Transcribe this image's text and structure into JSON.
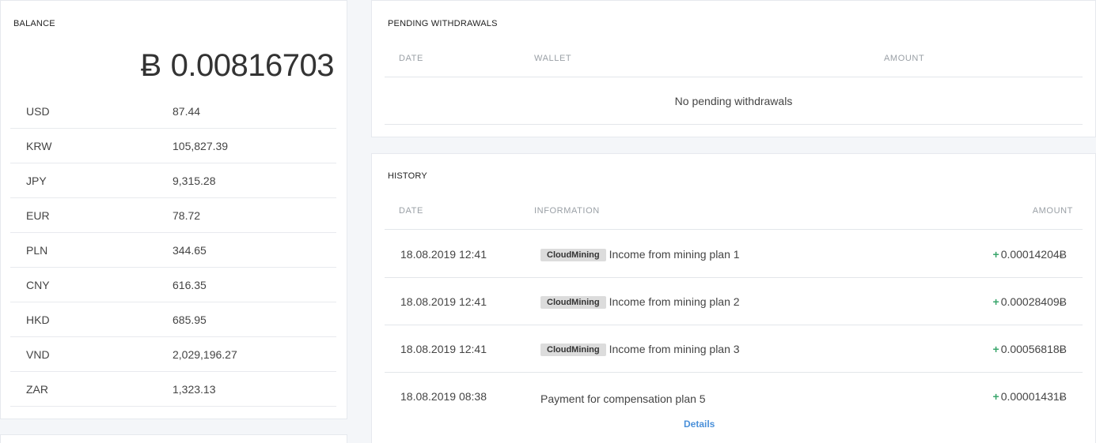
{
  "balance": {
    "title": "BALANCE",
    "symbol": "Ƀ",
    "amount": "0.00816703",
    "currencies": [
      {
        "code": "USD",
        "value": "87.44"
      },
      {
        "code": "KRW",
        "value": "105,827.39"
      },
      {
        "code": "JPY",
        "value": "9,315.28"
      },
      {
        "code": "EUR",
        "value": "78.72"
      },
      {
        "code": "PLN",
        "value": "344.65"
      },
      {
        "code": "CNY",
        "value": "616.35"
      },
      {
        "code": "HKD",
        "value": "685.95"
      },
      {
        "code": "VND",
        "value": "2,029,196.27"
      },
      {
        "code": "ZAR",
        "value": "1,323.13"
      }
    ]
  },
  "pending": {
    "title": "PENDING WITHDRAWALS",
    "columns": {
      "date": "DATE",
      "wallet": "WALLET",
      "amount": "AMOUNT"
    },
    "empty_text": "No pending withdrawals"
  },
  "history": {
    "title": "HISTORY",
    "columns": {
      "date": "DATE",
      "information": "INFORMATION",
      "amount": "AMOUNT"
    },
    "rows": [
      {
        "date": "18.08.2019 12:41",
        "tag": "CloudMining",
        "text": "Income from mining plan 1",
        "sign": "+",
        "amount": "0.00014204Ƀ"
      },
      {
        "date": "18.08.2019 12:41",
        "tag": "CloudMining",
        "text": "Income from mining plan 2",
        "sign": "+",
        "amount": "0.00028409Ƀ"
      },
      {
        "date": "18.08.2019 12:41",
        "tag": "CloudMining",
        "text": "Income from mining plan 3",
        "sign": "+",
        "amount": "0.00056818Ƀ"
      },
      {
        "date": "18.08.2019 08:38",
        "tag": "",
        "text": "Payment for compensation plan 5",
        "sign": "+",
        "amount": "0.00001431Ƀ",
        "details": "Details"
      }
    ]
  },
  "colors": {
    "positive": "#3aa66c",
    "link": "#4a90d9",
    "tag_bg": "#dcdcdc"
  }
}
